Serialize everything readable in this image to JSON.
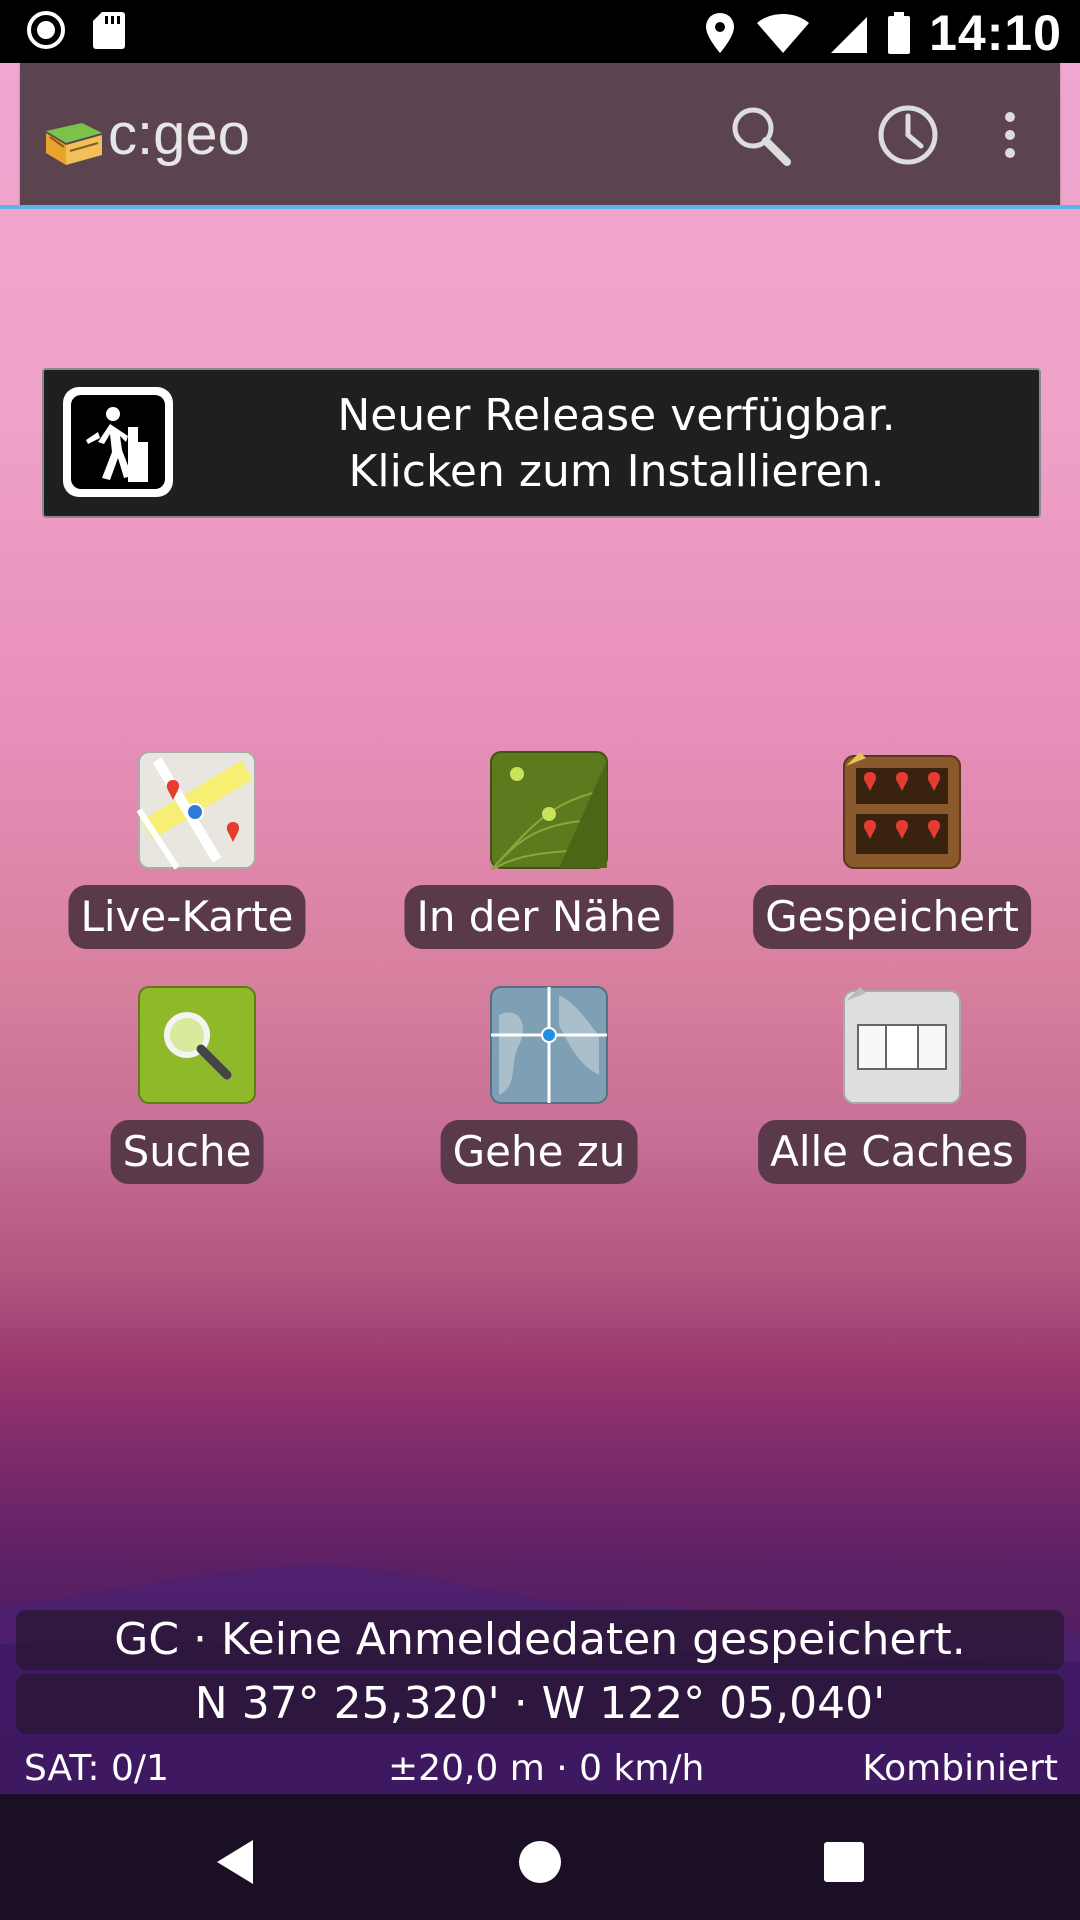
{
  "status_bar": {
    "time": "14:10",
    "icons": [
      "record-icon",
      "sd-card-icon",
      "location-pin-icon",
      "wifi-icon",
      "signal-icon",
      "battery-icon"
    ]
  },
  "app_bar": {
    "title": "c:geo",
    "actions": [
      "search-icon",
      "history-icon",
      "overflow-menu-icon"
    ]
  },
  "release_banner": {
    "line1": "Neuer Release verfügbar.",
    "line2": "Klicken zum Installieren."
  },
  "grid": {
    "items": [
      {
        "label": "Live-Karte",
        "icon": "live-map-icon"
      },
      {
        "label": "In der Nähe",
        "icon": "radar-nearby-icon"
      },
      {
        "label": "Gespeichert",
        "icon": "stored-shelf-icon"
      },
      {
        "label": "Suche",
        "icon": "search-magnifier-icon"
      },
      {
        "label": "Gehe zu",
        "icon": "globe-goto-icon"
      },
      {
        "label": "Alle Caches",
        "icon": "all-caches-box-icon"
      }
    ]
  },
  "status_info": {
    "login": "GC · Keine Anmeldedaten gespeichert.",
    "coords": "N 37° 25,320' · W 122° 05,040'",
    "sat": "SAT: 0/1",
    "accuracy": "±20,0 m · 0 km/h",
    "mode": "Kombiniert"
  },
  "nav_bar": [
    "back-icon",
    "home-icon",
    "recents-icon"
  ],
  "colors": {
    "appbar": "#5b4450",
    "accent": "#5fb3e6",
    "label_bg": "#5a3a4a"
  }
}
